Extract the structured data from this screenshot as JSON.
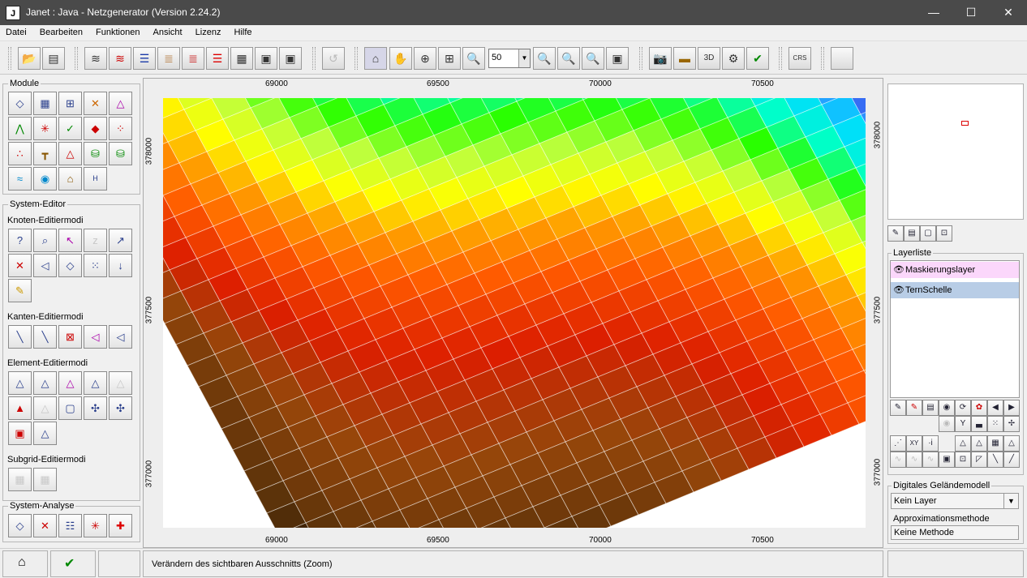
{
  "window": {
    "title": "Janet : Java - Netzgenerator (Version 2.24.2)",
    "logo": "J",
    "controls": {
      "minimize": "—",
      "maximize": "☐",
      "close": "✕"
    }
  },
  "menu": [
    "Datei",
    "Bearbeiten",
    "Funktionen",
    "Ansicht",
    "Lizenz",
    "Hilfe"
  ],
  "toolbar": {
    "zoom_value": "50",
    "icons": [
      "open-folder-icon",
      "save-icon",
      "import-icon",
      "md-import-icon",
      "layers-icon",
      "layer-open-icon",
      "layer-stack-icon",
      "layer-red-icon",
      "layer-grid-icon",
      "layer-save-icon",
      "layer-save-as-icon",
      "undo-icon",
      "select-pointer-icon",
      "pan-hand-icon",
      "zoom-extent-icon",
      "zoom-box-icon",
      "zoom-in-icon",
      "zoom-out-icon",
      "zoom-fit-icon",
      "zoom-window-icon",
      "zoom-layer-icon",
      "camera-icon",
      "ruler-icon",
      "3d-view-icon",
      "settings-doc-icon",
      "check-doc-icon",
      "crs-globe-icon",
      "blank-icon"
    ]
  },
  "left": {
    "module_title": "Module",
    "system_editor_title": "System-Editor",
    "knoten_label": "Knoten-Editiermodi",
    "kanten_label": "Kanten-Editiermodi",
    "element_label": "Element-Editiermodi",
    "subgrid_label": "Subgrid-Editiermodi",
    "analyse_title": "System-Analyse"
  },
  "map": {
    "x_ticks": [
      "69000",
      "69500",
      "70000",
      "70500"
    ],
    "y_ticks": [
      "378000",
      "377500",
      "377000"
    ]
  },
  "right": {
    "layerliste_title": "Layerliste",
    "layers": [
      {
        "name": "Maskierungslayer",
        "color": "#fbd7fb"
      },
      {
        "name": "TernSchelle",
        "color": "#b8cde6"
      }
    ],
    "dgm_title": "Digitales Geländemodell",
    "dgm_value": "Kein Layer",
    "approx_label": "Approximationsmethode",
    "approx_value": "Keine Methode"
  },
  "status": {
    "message": "Verändern des sichtbaren Ausschnitts (Zoom)"
  }
}
